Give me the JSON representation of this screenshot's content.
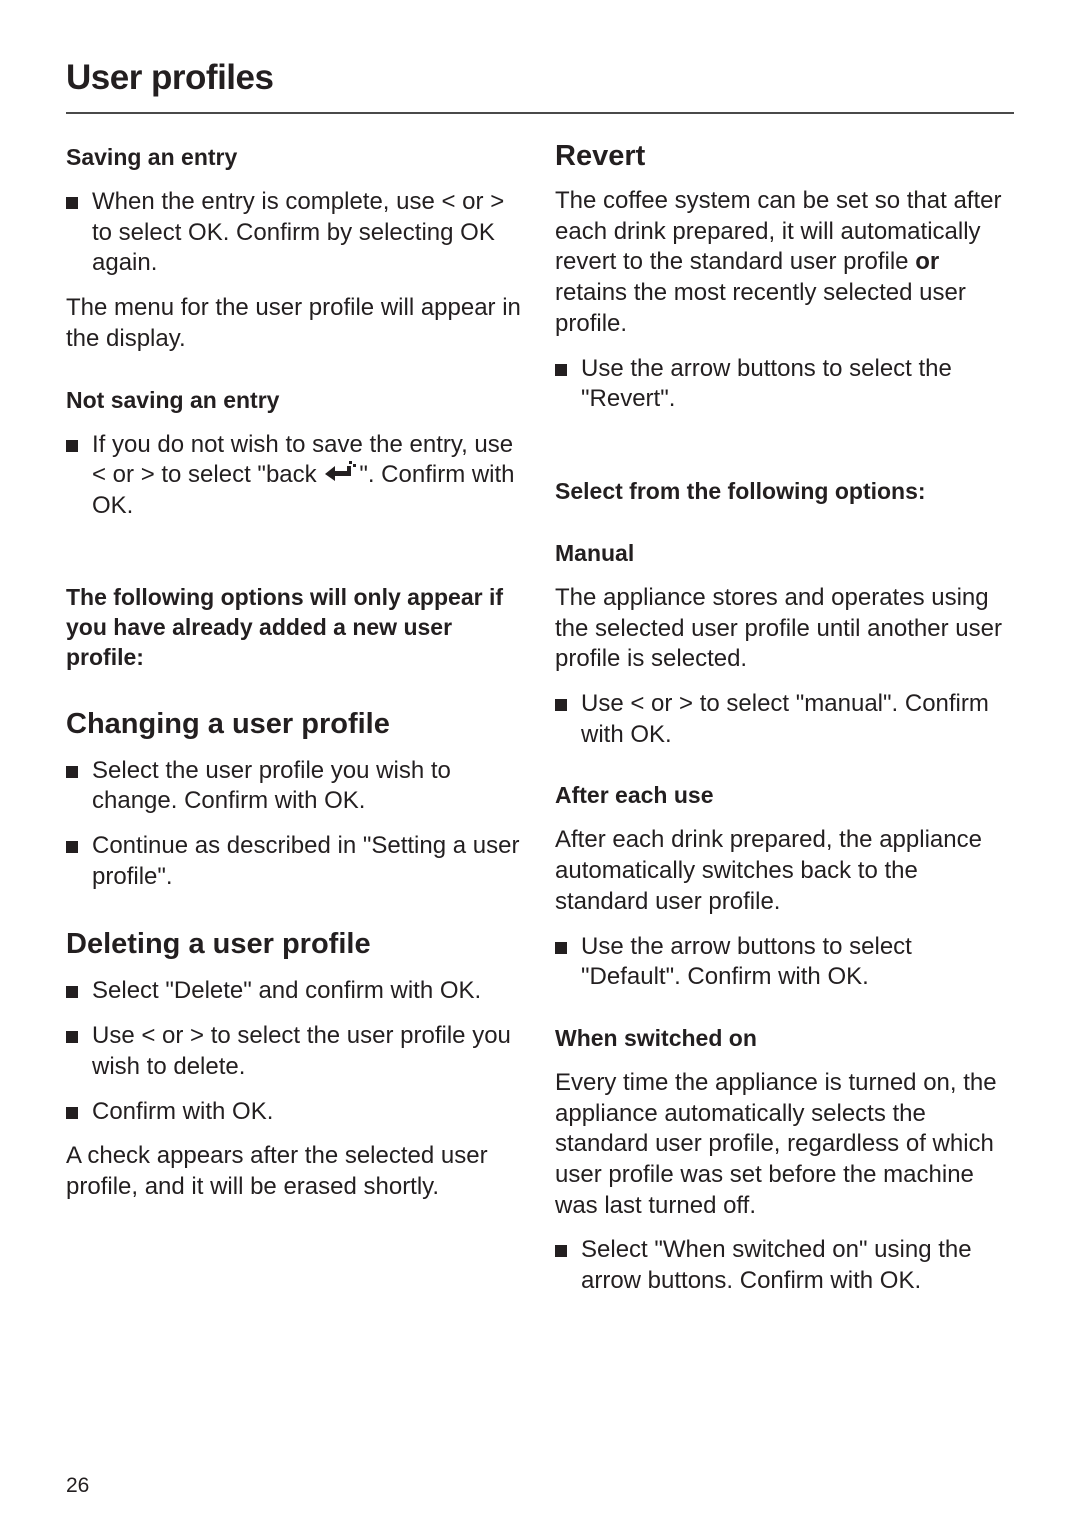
{
  "page": {
    "title": "User profiles",
    "page_number": "26"
  },
  "left": {
    "saving": {
      "heading": "Saving an entry",
      "bullet": "When the entry is complete, use < or > to select OK. Confirm by selecting OK again.",
      "para": "The menu for the user profile will appear in the display."
    },
    "not_saving": {
      "heading": "Not saving an entry",
      "bullet_part1": "If you do not wish to save the entry, use < or > to select \"back ",
      "bullet_part2": "\". Confirm with OK."
    },
    "note": "The following options will only appear if you have already added a new user profile:",
    "changing": {
      "heading": "Changing a user profile",
      "bullets": [
        "Select the user profile you wish to change. Confirm with OK.",
        "Continue as described in \"Setting a user profile\"."
      ]
    },
    "deleting": {
      "heading": "Deleting a user profile",
      "bullets": [
        "Select \"Delete\" and confirm with OK.",
        "Use < or > to select the user profile you wish to delete.",
        "Confirm with OK."
      ],
      "para": "A check appears after the selected user profile, and it will be erased shortly."
    }
  },
  "right": {
    "revert": {
      "heading": "Revert",
      "para_part1": "The coffee system can be set so that after each drink prepared, it will automatically revert to the standard user profile ",
      "para_bold": "or",
      "para_part2": " retains the most recently selected user profile.",
      "bullet": "Use the arrow buttons to select the \"Revert\"."
    },
    "options_heading": "Select from the following options:",
    "manual": {
      "heading": "Manual",
      "para": "The appliance stores and operates using the selected user profile until another user profile is selected.",
      "bullet": "Use < or > to select \"manual\". Confirm with OK."
    },
    "after_each_use": {
      "heading": "After each use",
      "para": "After each drink prepared, the appliance automatically switches back to the standard user profile.",
      "bullet": "Use the arrow buttons to select \"Default\". Confirm with OK."
    },
    "when_switched_on": {
      "heading": "When switched on",
      "para": "Every time the appliance is turned on, the appliance automatically selects the standard user profile, regardless of which user profile was set before the machine was last turned off.",
      "bullet": "Select \"When switched on\" using the arrow buttons. Confirm with OK."
    }
  }
}
